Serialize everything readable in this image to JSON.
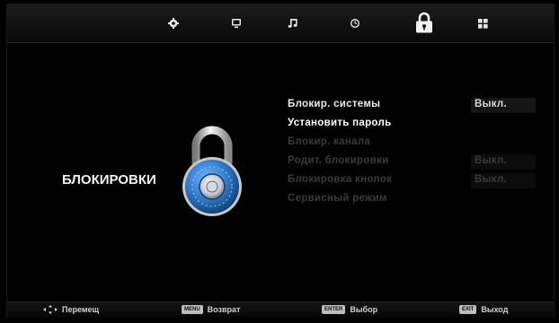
{
  "top_tabs": [
    {
      "name": "picture",
      "icon": "gear-icon"
    },
    {
      "name": "channel",
      "icon": "tv-icon"
    },
    {
      "name": "sound",
      "icon": "music-note-icon"
    },
    {
      "name": "time",
      "icon": "clock-icon"
    },
    {
      "name": "lock",
      "icon": "padlock-icon",
      "active": true
    },
    {
      "name": "setup",
      "icon": "grid-icon"
    }
  ],
  "section": {
    "title": "БЛОКИРОВКИ",
    "icon": "combination-lock-icon"
  },
  "menu": {
    "items": [
      {
        "label": "Блокир. системы",
        "value": "Выкл.",
        "state": "enabled"
      },
      {
        "label": "Установить пароль",
        "value": "",
        "state": "selected"
      },
      {
        "label": "Блокир. канала",
        "value": "",
        "state": "disabled"
      },
      {
        "label": "Родит. блокировки",
        "value": "Выкл.",
        "state": "disabled"
      },
      {
        "label": "Блокировка кнопок",
        "value": "Выкл.",
        "state": "disabled"
      },
      {
        "label": "Сервисный режим",
        "value": "",
        "state": "disabled"
      }
    ]
  },
  "hints": [
    {
      "key": "",
      "icon": "arrows-move-icon",
      "label": "Перемещ"
    },
    {
      "key": "MENU",
      "label": "Возврат"
    },
    {
      "key": "ENTER",
      "label": "Выбор"
    },
    {
      "key": "EXIT",
      "label": "Выход"
    }
  ],
  "colors": {
    "background": "#000000",
    "text": "#ffffff",
    "disabled_text": "#3a3a3a",
    "lock_blue": "#2f79c9",
    "lock_silver": "#c8c8c8"
  }
}
